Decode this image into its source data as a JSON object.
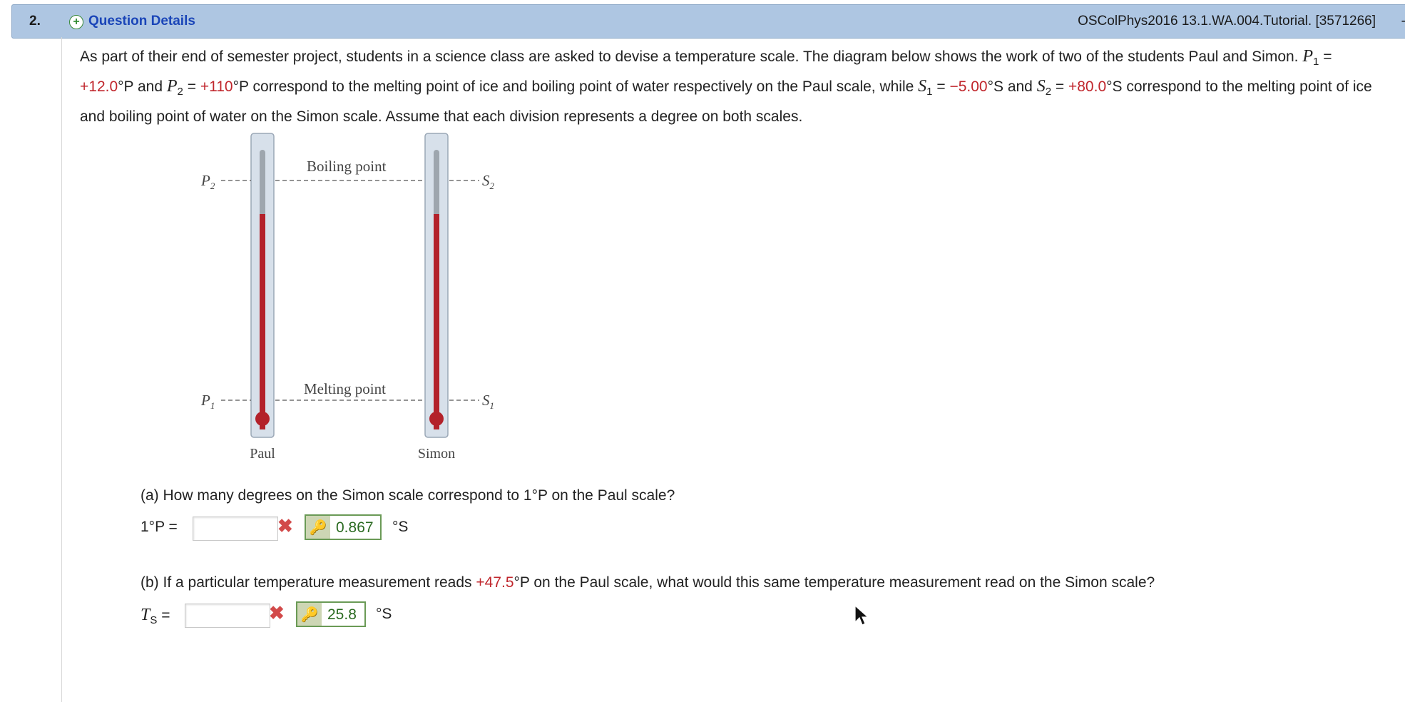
{
  "header": {
    "number": "2.",
    "title": "Question Details",
    "reference": "OSColPhys2016 13.1.WA.004.Tutorial. [3571266]",
    "dash": "-"
  },
  "problem": {
    "text_1": "As part of their end of semester project, students in a science class are asked to devise a temperature scale. The diagram below shows the work of two of the students Paul and Simon. ",
    "p1_symbol": "P",
    "p1_sub": "1",
    "eq": " = ",
    "p1_value": "+12.0",
    "p1_unit": "°P and ",
    "p2_symbol": "P",
    "p2_sub": "2",
    "p2_value": "+110",
    "p2_unit": "°P correspond to the melting point of ice and boiling point of water respectively on the Paul scale, while ",
    "s1_symbol": "S",
    "s1_sub": "1",
    "s1_value": "−5.00",
    "s1_unit": "°S and ",
    "s2_symbol": "S",
    "s2_sub": "2",
    "s2_value": "+80.0",
    "s2_unit": "°S correspond to the melting point of ice and boiling point of water on the Simon scale. Assume that each division represents a degree on both scales."
  },
  "diagram": {
    "boiling_label": "Boiling point",
    "melting_label": "Melting point",
    "left_name": "Paul",
    "right_name": "Simon",
    "p_symbol": "P",
    "s_symbol": "S",
    "sub_1": "1",
    "sub_2": "2"
  },
  "part_a": {
    "question": "(a) How many degrees on the Simon scale correspond to 1°P on the Paul scale?",
    "label": "1°P =",
    "input_value": "",
    "answer": "0.867",
    "unit": "°S"
  },
  "part_b": {
    "question_1": "(b) If a particular temperature measurement reads ",
    "highlight": "+47.5",
    "question_2": "°P on the Paul scale, what would this same temperature measurement read on the Simon scale?",
    "label_symbol": "T",
    "label_sub": "S",
    "label_eq": " =",
    "input_value": "",
    "answer": "25.8",
    "unit": "°S"
  },
  "colors": {
    "header_bg": "#aec6e2",
    "title_blue": "#1a45b8",
    "value_red": "#c0262c",
    "answer_green": "#2a6a20",
    "mercury": "#b3212a"
  }
}
